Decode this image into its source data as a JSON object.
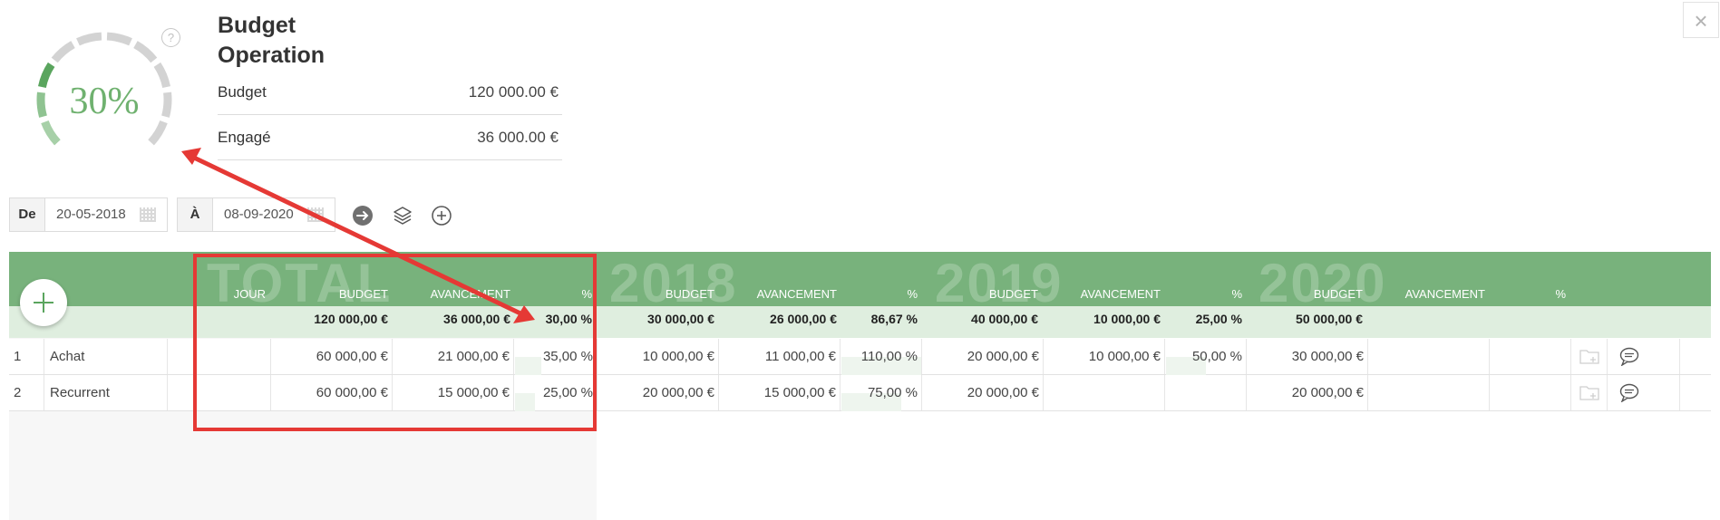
{
  "gauge": {
    "percent_label": "30%",
    "fraction": 0.3,
    "help": "?"
  },
  "title": {
    "line1": "Budget",
    "line2": "Operation"
  },
  "summary": [
    {
      "label": "Budget",
      "value": "120 000.00 €"
    },
    {
      "label": "Engagé",
      "value": "36 000.00 €"
    }
  ],
  "close_glyph": "×",
  "filters": {
    "from_label": "De",
    "from_value": "20-05-2018",
    "to_label": "À",
    "to_value": "08-09-2020"
  },
  "icons": {
    "go": "arrow-right-circle-icon",
    "layers": "layers-icon",
    "add": "plus-circle-icon",
    "folder": "folder-add-icon",
    "comment": "comment-icon"
  },
  "table": {
    "groups": [
      {
        "title": "TOTAL",
        "headers": [
          "JOUR",
          "BUDGET",
          "AVANCEMENT",
          "%"
        ],
        "totals": [
          "",
          "120 000,00 €",
          "36 000,00 €",
          "30,00 %"
        ]
      },
      {
        "title": "2018",
        "headers": [
          "BUDGET",
          "AVANCEMENT",
          "%"
        ],
        "totals": [
          "30 000,00 €",
          "26 000,00 €",
          "86,67 %"
        ]
      },
      {
        "title": "2019",
        "headers": [
          "BUDGET",
          "AVANCEMENT",
          "%"
        ],
        "totals": [
          "40 000,00 €",
          "10 000,00 €",
          "25,00 %"
        ]
      },
      {
        "title": "2020",
        "headers": [
          "BUDGET",
          "AVANCEMENT",
          "%"
        ],
        "totals": [
          "50 000,00 €",
          "",
          ""
        ]
      }
    ],
    "rows": [
      {
        "num": "1",
        "name": "Achat",
        "total": [
          "",
          "60 000,00 €",
          "21 000,00 €",
          "35,00 %"
        ],
        "y2018": [
          "10 000,00 €",
          "11 000,00 €",
          "110,00 %"
        ],
        "y2019": [
          "20 000,00 €",
          "10 000,00 €",
          "50,00 %"
        ],
        "y2020": [
          "30 000,00 €",
          "",
          ""
        ]
      },
      {
        "num": "2",
        "name": "Recurrent",
        "total": [
          "",
          "60 000,00 €",
          "15 000,00 €",
          "25,00 %"
        ],
        "y2018": [
          "20 000,00 €",
          "15 000,00 €",
          "75,00 %"
        ],
        "y2019": [
          "20 000,00 €",
          "",
          ""
        ],
        "y2020": [
          "20 000,00 €",
          "",
          ""
        ]
      }
    ]
  },
  "colors": {
    "accent": "#78b27c",
    "gauge_on": "#6fb16f",
    "gauge_off": "#d3d3d3",
    "annotation": "#e53935"
  }
}
